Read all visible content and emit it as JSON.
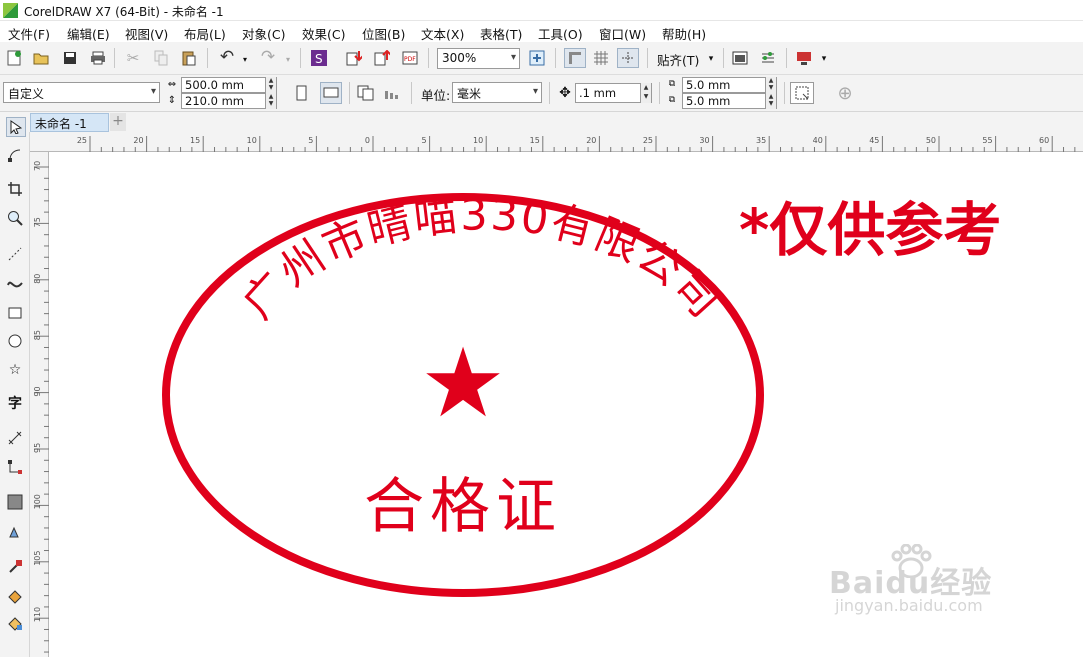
{
  "window": {
    "title": "CorelDRAW X7 (64-Bit) - 未命名 -1"
  },
  "menu": [
    "文件(F)",
    "编辑(E)",
    "视图(V)",
    "布局(L)",
    "对象(C)",
    "效果(C)",
    "位图(B)",
    "文本(X)",
    "表格(T)",
    "工具(O)",
    "窗口(W)",
    "帮助(H)"
  ],
  "toolbar": {
    "zoom": "300%",
    "snap_label": "贴齐(T)"
  },
  "propbar": {
    "page_preset": "自定义",
    "width": "500.0 mm",
    "height": "210.0 mm",
    "unit_label": "单位:",
    "unit": "毫米",
    "nudge": ".1 mm",
    "dup_x": "5.0 mm",
    "dup_y": "5.0 mm"
  },
  "tabs": {
    "doc": "未命名 -1",
    "add": "+"
  },
  "ruler": {
    "h": [
      "25",
      "20",
      "15",
      "10",
      "5",
      "0",
      "5",
      "10",
      "15",
      "20",
      "25",
      "30",
      "35",
      "40",
      "45",
      "50",
      "55",
      "60"
    ],
    "v": [
      "70",
      "75",
      "80",
      "85",
      "90",
      "95",
      "100",
      "105",
      "110"
    ]
  },
  "seal": {
    "company": "广州市晴喵330有限公司",
    "label": "合格证",
    "star": "★"
  },
  "disclaimer": "*仅供参考",
  "watermark": {
    "brand": "Baidu经验",
    "url": "jingyan.baidu.com"
  },
  "colors": {
    "seal_red": "#e0001b",
    "accent_green": "#2e9a3a"
  }
}
